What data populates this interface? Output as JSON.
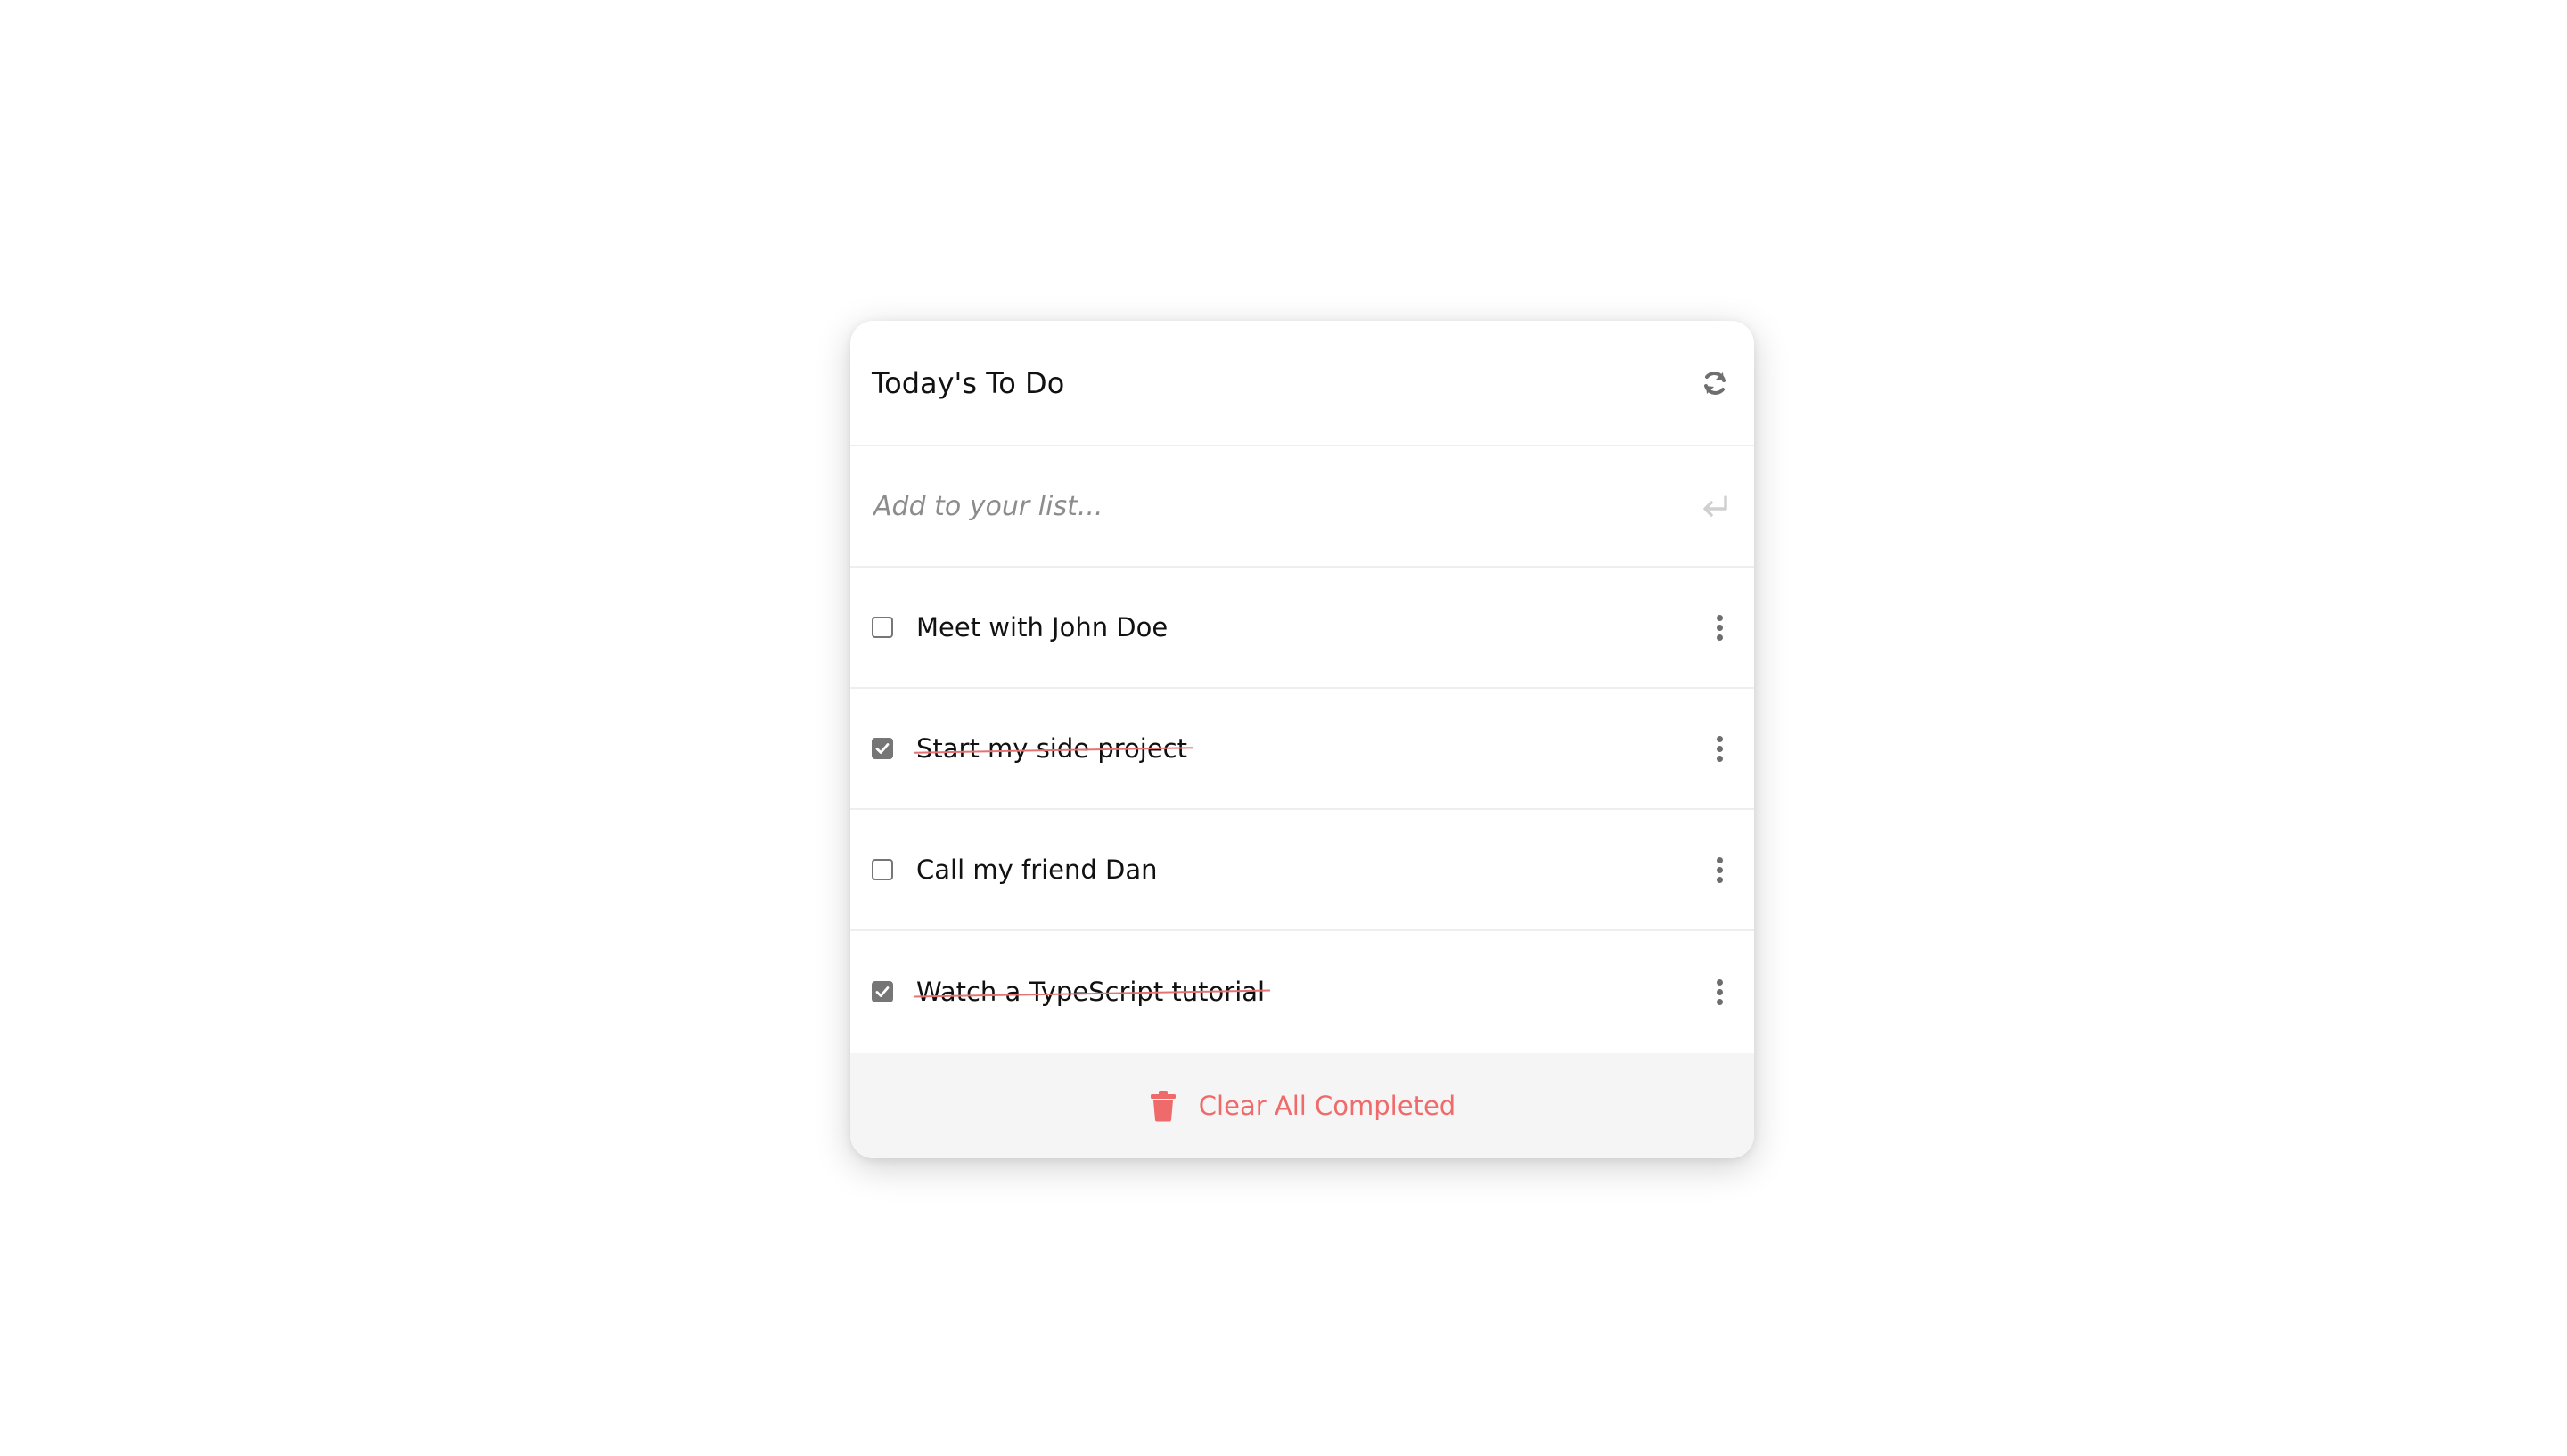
{
  "header": {
    "title": "Today's To Do",
    "refresh_icon": "refresh-icon"
  },
  "add": {
    "placeholder": "Add to your list...",
    "value": "",
    "enter_icon": "enter-icon"
  },
  "todos": [
    {
      "text": "Meet with John Doe",
      "completed": false
    },
    {
      "text": "Start my side project",
      "completed": true
    },
    {
      "text": "Call my friend Dan",
      "completed": false
    },
    {
      "text": "Watch a TypeScript tutorial",
      "completed": true
    }
  ],
  "footer": {
    "clear_label": "Clear All Completed",
    "trash_icon": "trash-icon"
  },
  "colors": {
    "accent": "#ef6b6b",
    "strike": "#e57373",
    "checkbox": "#767676",
    "footer_bg": "#f5f5f5"
  }
}
